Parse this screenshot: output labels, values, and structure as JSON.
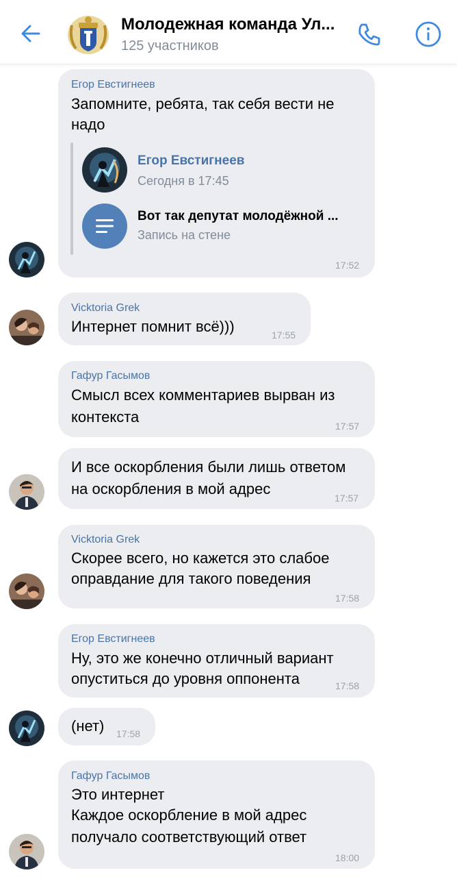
{
  "header": {
    "title": "Молодежная команда Ул...",
    "subtitle": "125 участников",
    "icons": [
      "back-arrow-icon",
      "group-crest-icon",
      "phone-icon",
      "info-icon"
    ],
    "accent_color": "#3f8ae0"
  },
  "messages": [
    {
      "author": "Егор Евстигнеев",
      "lines": [
        "Запомните, ребята, так себя вести не",
        "надо"
      ],
      "repost": {
        "name": "Егор Евстигнеев",
        "date": "Сегодня в 17:45",
        "wall_title": "Вот так депутат молодёжной ...",
        "wall_subtitle": "Запись на стене"
      },
      "time": "17:52"
    },
    {
      "author": "Vicktoria Grek",
      "lines": [
        "Интернет помнит всё)))"
      ],
      "time": "17:55"
    },
    {
      "author": "Гафур Гасымов",
      "lines": [
        "Смысл всех комментариев вырван из",
        "контекста"
      ],
      "time": "17:57"
    },
    {
      "author": "",
      "lines": [
        "И все оскорбления были лишь ответом",
        "на оскорбления в мой адрес"
      ],
      "time": "17:57"
    },
    {
      "author": "Vicktoria Grek",
      "lines": [
        "Скорее всего, но кажется это слабое",
        "оправдание для такого поведения"
      ],
      "time": "17:58"
    },
    {
      "author": "Егор Евстигнеев",
      "lines": [
        "Ну, это же конечно отличный вариант",
        "опуститься до уровня оппонента"
      ],
      "time": "17:58"
    },
    {
      "author": "",
      "lines": [
        "(нет)"
      ],
      "time": "17:58"
    },
    {
      "author": "Гафур Гасымов",
      "lines": [
        "Это интернет",
        "Каждое оскорбление в мой адрес",
        "получало соответствующий ответ"
      ],
      "time": "18:00"
    }
  ],
  "colors": {
    "bubble": "#ebedf0",
    "author": "#4a73a6",
    "time": "#99a2ad",
    "secondary": "#818c99"
  }
}
